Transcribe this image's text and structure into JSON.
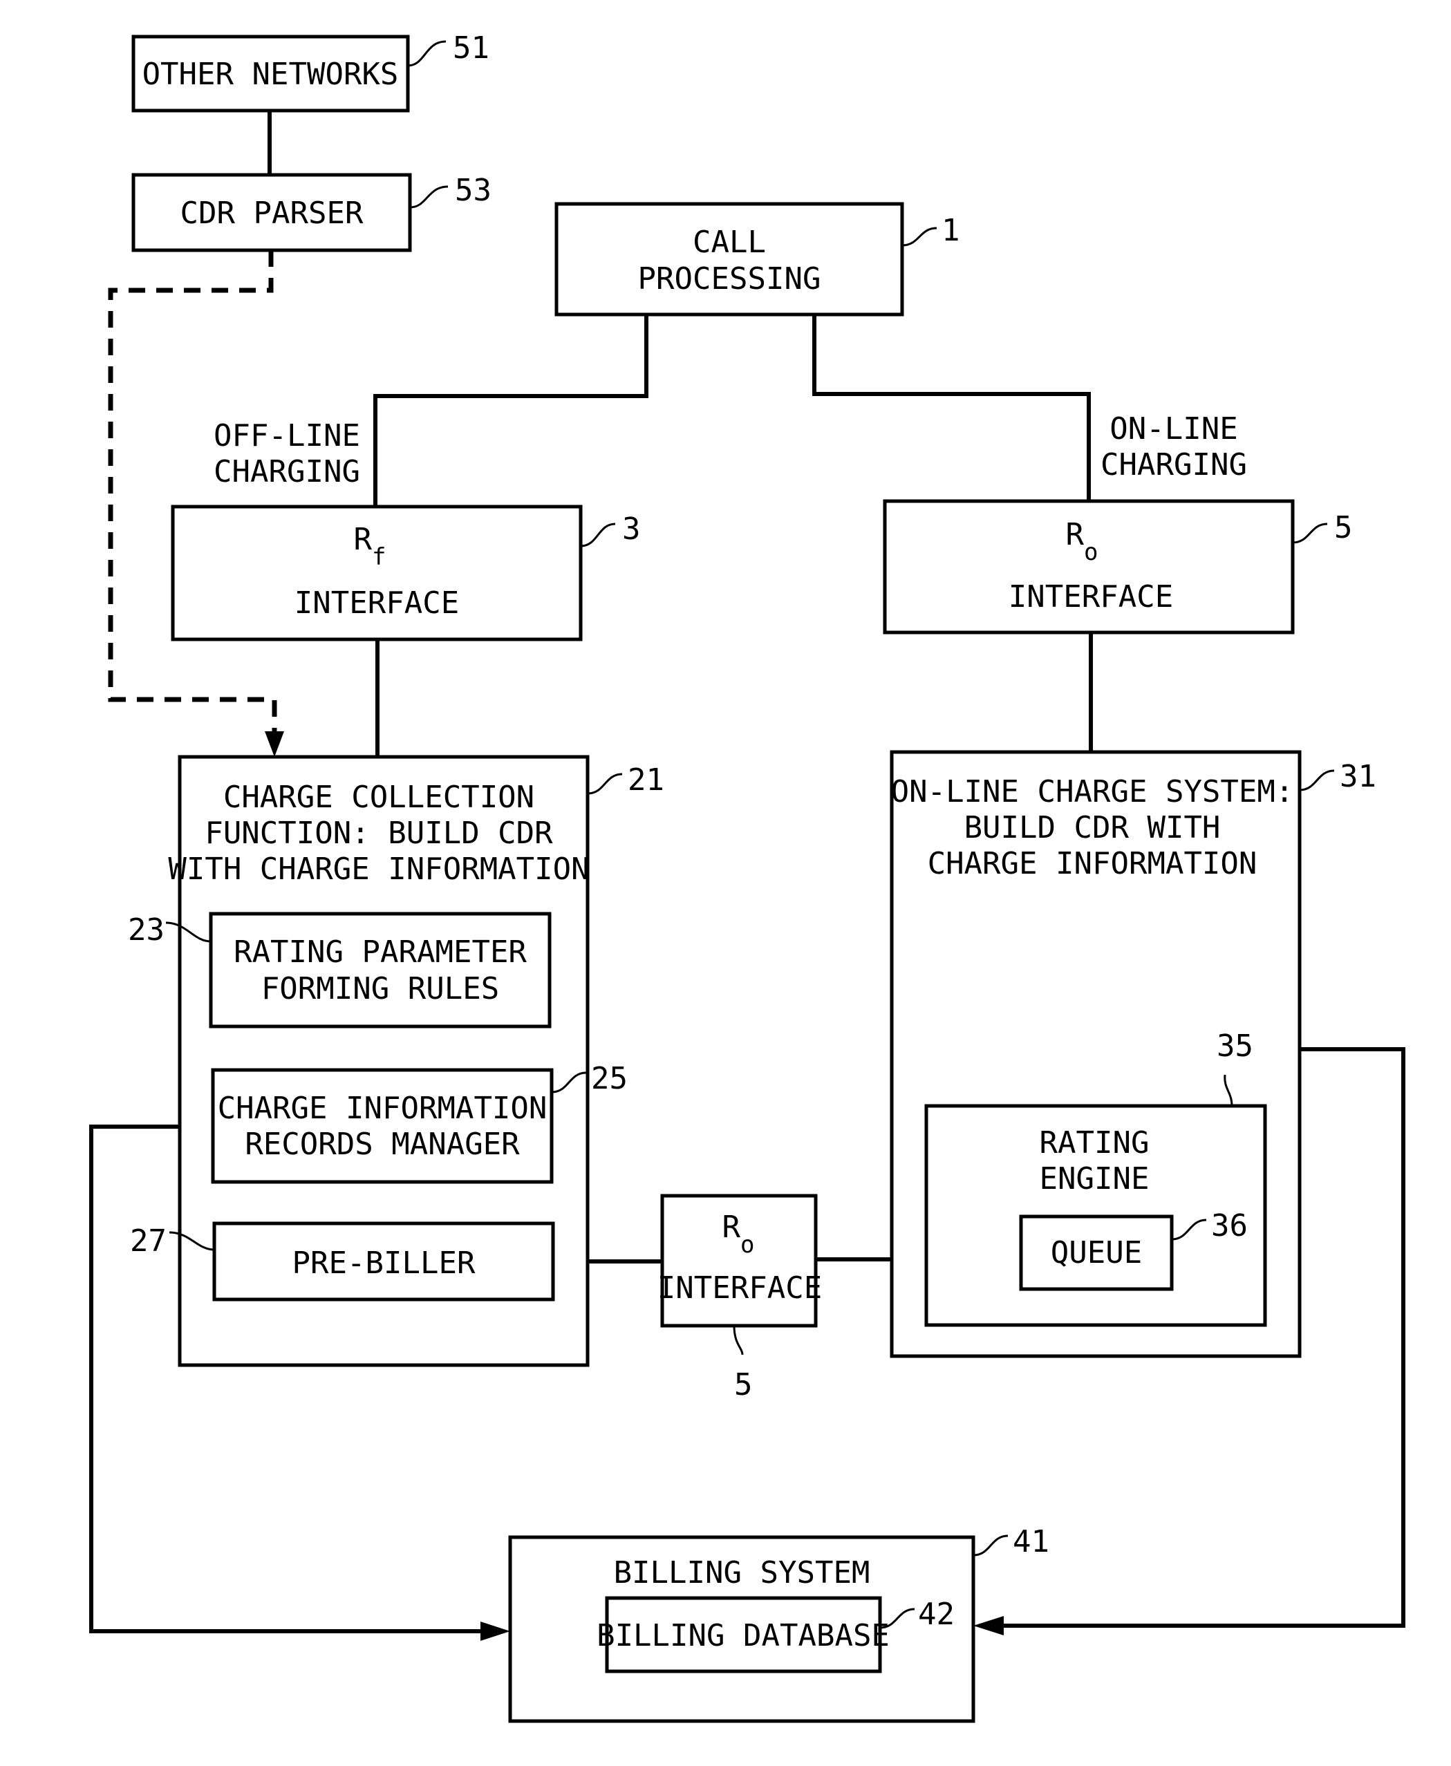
{
  "figure": {
    "boxes": {
      "other_networks": {
        "ref": "51",
        "lines": [
          "OTHER NETWORKS"
        ]
      },
      "cdr_parser": {
        "ref": "53",
        "lines": [
          "CDR PARSER"
        ]
      },
      "call_processing": {
        "ref": "1",
        "lines": [
          "CALL",
          "PROCESSING"
        ]
      },
      "rf_interface": {
        "ref": "3",
        "symbol": "R",
        "subscript": "f",
        "lines": [
          "INTERFACE"
        ]
      },
      "ro_interface_top": {
        "ref": "5",
        "symbol": "R",
        "subscript": "o",
        "lines": [
          "INTERFACE"
        ]
      },
      "charge_collection": {
        "ref": "21",
        "lines": [
          "CHARGE COLLECTION",
          "FUNCTION: BUILD CDR",
          "WITH CHARGE INFORMATION"
        ]
      },
      "rating_parameter": {
        "ref": "23",
        "lines": [
          "RATING PARAMETER",
          "FORMING RULES"
        ]
      },
      "charge_info_manager": {
        "ref": "25",
        "lines": [
          "CHARGE INFORMATION",
          "RECORDS MANAGER"
        ]
      },
      "pre_biller": {
        "ref": "27",
        "lines": [
          "PRE-BILLER"
        ]
      },
      "ro_interface_bottom": {
        "ref": "5",
        "symbol": "R",
        "subscript": "o",
        "lines": [
          "INTERFACE"
        ]
      },
      "online_charge_system": {
        "ref": "31",
        "lines": [
          "ON-LINE CHARGE SYSTEM:",
          "BUILD CDR WITH",
          "CHARGE INFORMATION"
        ]
      },
      "rating_engine": {
        "ref": "35",
        "lines": [
          "RATING",
          "ENGINE"
        ]
      },
      "queue": {
        "ref": "36",
        "lines": [
          "QUEUE"
        ]
      },
      "billing_system": {
        "ref": "41",
        "lines": [
          "BILLING SYSTEM"
        ]
      },
      "billing_database": {
        "ref": "42",
        "lines": [
          "BILLING DATABASE"
        ]
      }
    },
    "branch_labels": {
      "offline": [
        "OFF-LINE",
        "CHARGING"
      ],
      "online": [
        "ON-LINE",
        "CHARGING"
      ]
    }
  }
}
